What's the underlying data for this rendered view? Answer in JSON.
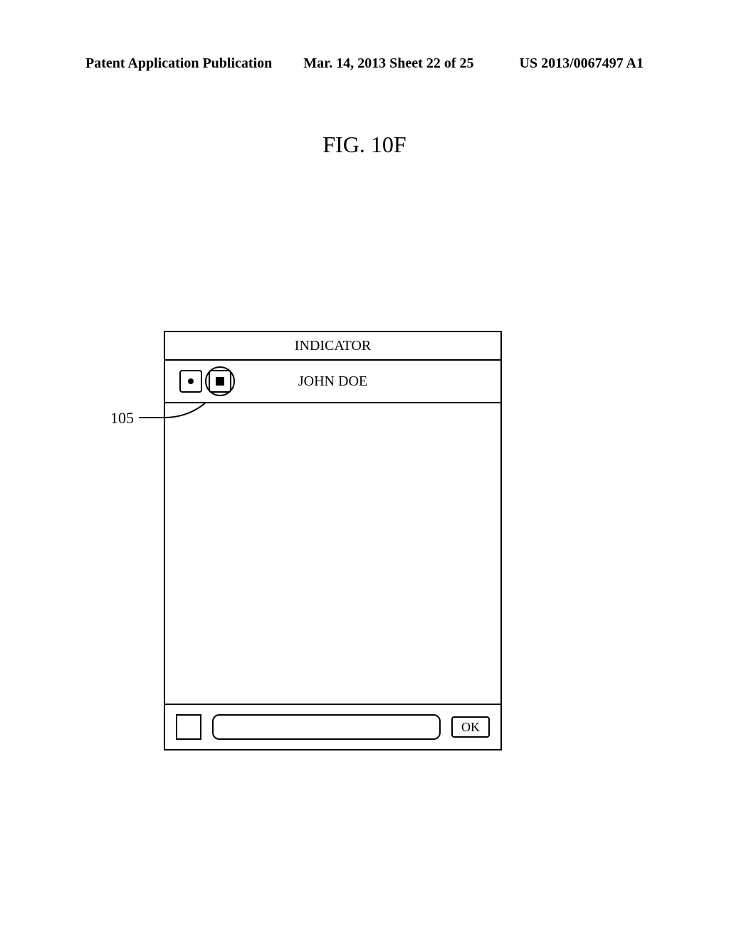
{
  "header": {
    "left": "Patent Application Publication",
    "center": "Mar. 14, 2013  Sheet 22 of 25",
    "right": "US 2013/0067497 A1"
  },
  "figure_title": "FIG. 10F",
  "device": {
    "indicator_label": "INDICATOR",
    "user_name": "JOHN DOE",
    "ok_label": "OK"
  },
  "callout": {
    "ref_num": "105"
  }
}
